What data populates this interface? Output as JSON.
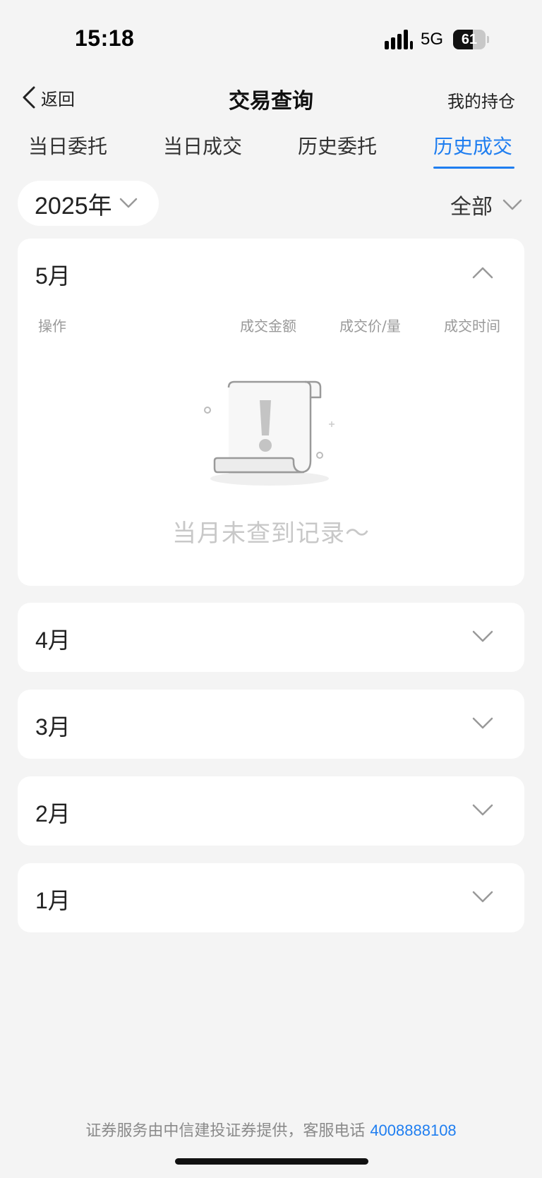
{
  "status_bar": {
    "time": "15:18",
    "network": "5G",
    "battery": "61",
    "battery_level": 0.61
  },
  "nav": {
    "back_label": "返回",
    "title": "交易查询",
    "right_label": "我的持仓"
  },
  "tabs": [
    {
      "label": "当日委托",
      "active": false
    },
    {
      "label": "当日成交",
      "active": false
    },
    {
      "label": "历史委托",
      "active": false
    },
    {
      "label": "历史成交",
      "active": true
    }
  ],
  "filters": {
    "year": "2025年",
    "type": "全部"
  },
  "columns": [
    "操作",
    "成交金额",
    "成交价/量",
    "成交时间"
  ],
  "months": [
    {
      "label": "5月",
      "expanded": true
    },
    {
      "label": "4月",
      "expanded": false
    },
    {
      "label": "3月",
      "expanded": false
    },
    {
      "label": "2月",
      "expanded": false
    },
    {
      "label": "1月",
      "expanded": false
    }
  ],
  "empty_state": {
    "text": "当月未查到记录～"
  },
  "footer": {
    "text": "证券服务由中信建投证券提供，客服电话 ",
    "phone": "4008888108"
  },
  "colors": {
    "accent": "#1f7ef0",
    "background": "#f4f4f4",
    "card": "#ffffff"
  },
  "icons": [
    "signal-icon",
    "battery-icon",
    "back-chevron-icon",
    "chevron-down-icon",
    "chevron-up-icon",
    "empty-document-icon"
  ]
}
